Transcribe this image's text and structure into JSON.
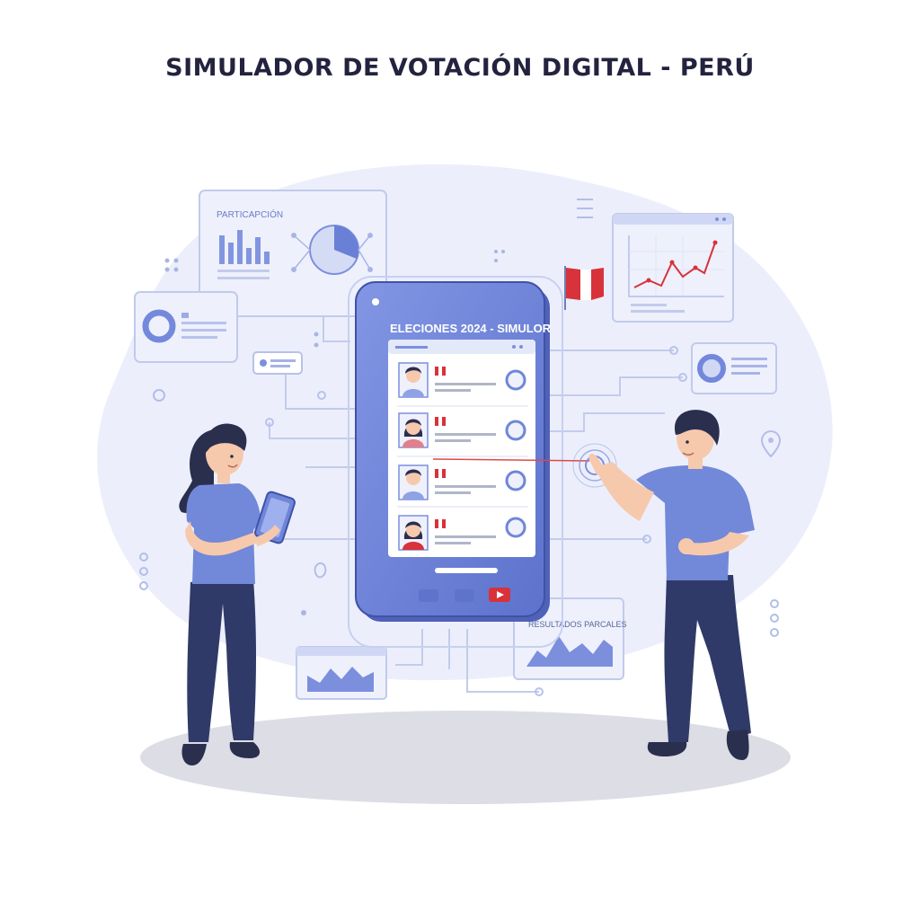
{
  "header": {
    "title": "SIMULADOR DE VOTACIÓN DIGITAL - PERÚ"
  },
  "panels": {
    "participation_label": "PARTICAPCIÓN",
    "partial_results_label": "RESULTADOS PARCALES"
  },
  "phone": {
    "screen_title": "ELECIONES 2024 - SIMULOR",
    "candidates": [
      {
        "avatar": "male-avatar-icon",
        "vote_state": "unselected"
      },
      {
        "avatar": "female-avatar-icon",
        "vote_state": "unselected"
      },
      {
        "avatar": "male-avatar-icon",
        "vote_state": "unselected"
      },
      {
        "avatar": "female-avatar-icon",
        "vote_state": "unselected"
      }
    ],
    "bottom_icons": [
      "app-icon",
      "app-icon",
      "play-icon"
    ]
  },
  "colors": {
    "primary": "#6f86d8",
    "primary_dark": "#5468c4",
    "accent_red": "#d8323a",
    "text_dark": "#23233f",
    "pants": "#2f3a68",
    "skin": "#f6c9ad"
  }
}
